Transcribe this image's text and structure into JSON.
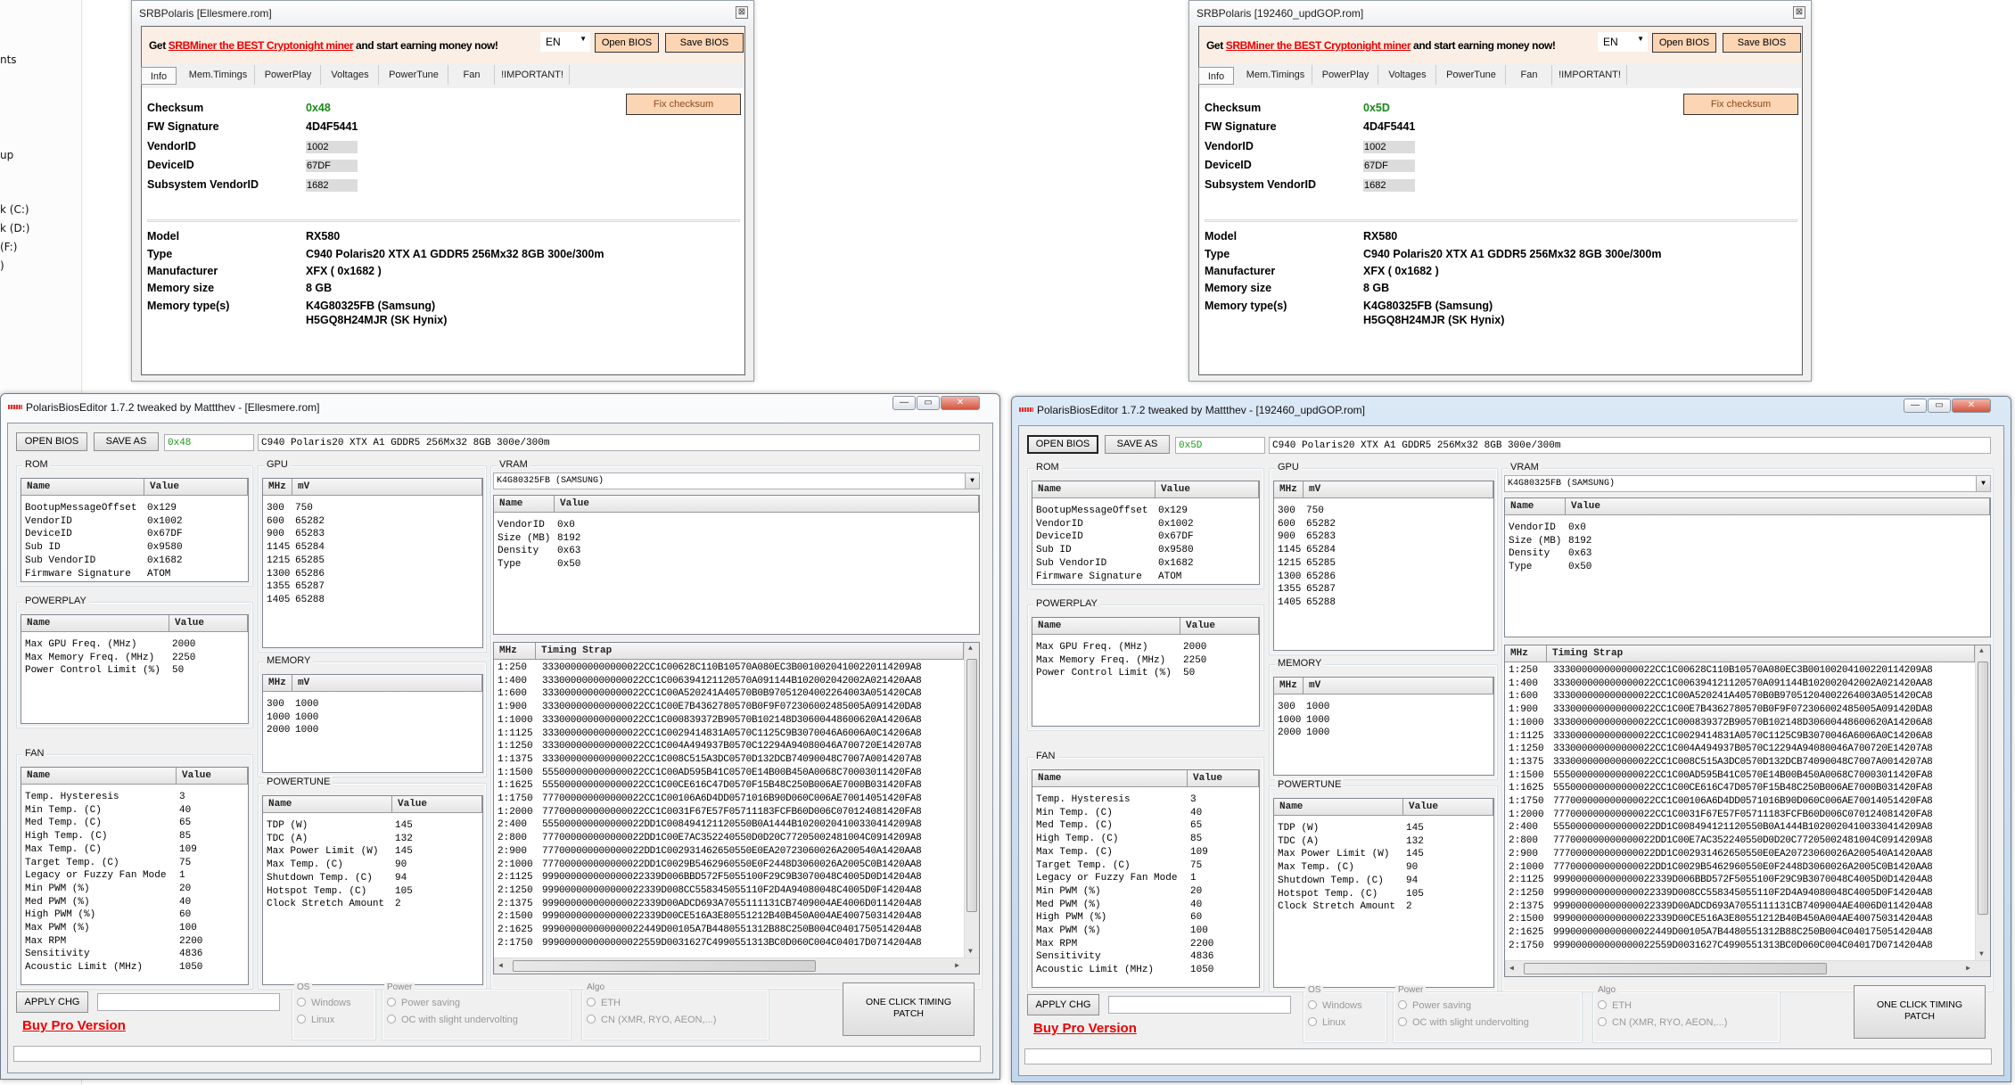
{
  "explorer": {
    "items": [
      "nts",
      "up",
      "k (C:)",
      "k (D:)",
      " (F:)",
      ")"
    ]
  },
  "srb": {
    "promo_prefix": "Get ",
    "promo_link": "SRBMiner the BEST Cryptonight miner",
    "promo_suffix": " and start earning money now!",
    "language": "EN",
    "open_bios": "Open BIOS",
    "save_bios": "Save BIOS",
    "close_glyph": "⊠",
    "tabs": [
      "Info",
      "Mem.Timings",
      "PowerPlay",
      "Voltages",
      "PowerTune",
      "Fan",
      "!IMPORTANT!"
    ],
    "fix_checksum": "Fix checksum",
    "labels": {
      "checksum": "Checksum",
      "fw": "FW Signature",
      "vendor": "VendorID",
      "device": "DeviceID",
      "subsys": "Subsystem VendorID",
      "model": "Model",
      "type": "Type",
      "manufacturer": "Manufacturer",
      "mem_size": "Memory size",
      "mem_types": "Memory type(s)"
    },
    "values": {
      "fw": "4D4F5441",
      "vendor": "1002",
      "device": "67DF",
      "subsys": "1682",
      "model": "RX580",
      "type": "C940 Polaris20 XTX A1 GDDR5 256Mx32 8GB 300e/300m",
      "manufacturer": "XFX ( 0x1682 )",
      "mem_size": "8 GB",
      "mem_type_1": "K4G80325FB (Samsung)",
      "mem_type_2": "H5GQ8H24MJR (SK Hynix)"
    },
    "checksum_color": "#1a8a1a"
  },
  "srb_windows": [
    {
      "title": "SRBPolaris [Ellesmere.rom]",
      "checksum": "0x48"
    },
    {
      "title": "SRBPolaris [192460_updGOP.rom]",
      "checksum": "0x5D"
    }
  ],
  "pbe_windows": [
    {
      "title": "PolarisBiosEditor 1.7.2 tweaked by Mattthev  - [Ellesmere.rom]",
      "checksum": "0x48",
      "active": false
    },
    {
      "title": "PolarisBiosEditor 1.7.2 tweaked by Mattthev  - [192460_updGOP.rom]",
      "checksum": "0x5D",
      "active": true
    }
  ],
  "pbe": {
    "window_buttons": [
      "—",
      "▭",
      "✕"
    ],
    "open_bios": "OPEN BIOS",
    "save_as": "SAVE AS",
    "type_string": "C940 Polaris20 XTX A1 GDDR5 256Mx32 8GB 300e/300m",
    "rom": {
      "title": "ROM",
      "headers": [
        "Name",
        "Value"
      ],
      "rows": [
        [
          "BootupMessageOffset",
          "0x129"
        ],
        [
          "VendorID",
          "0x1002"
        ],
        [
          "DeviceID",
          "0x67DF"
        ],
        [
          "Sub ID",
          "0x9580"
        ],
        [
          "Sub VendorID",
          "0x1682"
        ],
        [
          "Firmware Signature",
          "ATOM"
        ]
      ]
    },
    "powerplay": {
      "title": "POWERPLAY",
      "headers": [
        "Name",
        "Value"
      ],
      "rows": [
        [
          "Max GPU Freq. (MHz)",
          "2000"
        ],
        [
          "Max Memory Freq. (MHz)",
          "2250"
        ],
        [
          "Power Control Limit (%)",
          "50"
        ]
      ]
    },
    "fan": {
      "title": "FAN",
      "headers": [
        "Name",
        "Value"
      ],
      "rows": [
        [
          "Temp. Hysteresis",
          "3"
        ],
        [
          "Min Temp. (C)",
          "40"
        ],
        [
          "Med Temp. (C)",
          "65"
        ],
        [
          "High Temp. (C)",
          "85"
        ],
        [
          "Max Temp. (C)",
          "109"
        ],
        [
          "Target Temp. (C)",
          "75"
        ],
        [
          "Legacy or Fuzzy Fan Mode",
          "1"
        ],
        [
          "Min PWM (%)",
          "20"
        ],
        [
          "Med PWM (%)",
          "40"
        ],
        [
          "High PWM (%)",
          "60"
        ],
        [
          "Max PWM (%)",
          "100"
        ],
        [
          "Max RPM",
          "2200"
        ],
        [
          "Sensitivity",
          "4836"
        ],
        [
          "Acoustic Limit (MHz)",
          "1050"
        ]
      ]
    },
    "gpu": {
      "title": "GPU",
      "headers": [
        "MHz",
        "mV"
      ],
      "rows": [
        [
          "300",
          "750"
        ],
        [
          "600",
          "65282"
        ],
        [
          "900",
          "65283"
        ],
        [
          "1145",
          "65284"
        ],
        [
          "1215",
          "65285"
        ],
        [
          "1300",
          "65286"
        ],
        [
          "1355",
          "65287"
        ],
        [
          "1405",
          "65288"
        ]
      ]
    },
    "memory": {
      "title": "MEMORY",
      "headers": [
        "MHz",
        "mV"
      ],
      "rows": [
        [
          "300",
          "1000"
        ],
        [
          "1000",
          "1000"
        ],
        [
          "2000",
          "1000"
        ]
      ]
    },
    "powertune": {
      "title": "POWERTUNE",
      "headers": [
        "Name",
        "Value"
      ],
      "rows": [
        [
          "TDP (W)",
          "145"
        ],
        [
          "TDC (A)",
          "132"
        ],
        [
          "Max Power Limit (W)",
          "145"
        ],
        [
          "Max Temp. (C)",
          "90"
        ],
        [
          "Shutdown Temp. (C)",
          "94"
        ],
        [
          "Hotspot Temp. (C)",
          "105"
        ],
        [
          "Clock Stretch Amount",
          "2"
        ]
      ]
    },
    "vram": {
      "title": "VRAM",
      "selected": "K4G80325FB (SAMSUNG)",
      "headers": [
        "Name",
        "Value"
      ],
      "rows": [
        [
          "VendorID",
          "0x0"
        ],
        [
          "Size (MB)",
          "8192"
        ],
        [
          "Density",
          "0x63"
        ],
        [
          "Type",
          "0x50"
        ]
      ]
    },
    "timings": {
      "headers": [
        "MHz",
        "Timing Strap"
      ],
      "rows": [
        [
          "1:250",
          "333000000000000022CC1C00628C110B10570A080EC3B00100204100220114209A8"
        ],
        [
          "1:400",
          "333000000000000022CC1C006394121120570A091144B102002042002A021420AA8"
        ],
        [
          "1:600",
          "333000000000000022CC1C00A520241A40570B0B97051204002264003A051420CA8"
        ],
        [
          "1:900",
          "333000000000000022CC1C00E7B4362780570B0F9F072306002485005A091420DA8"
        ],
        [
          "1:1000",
          "333000000000000022CC1C000839372B90570B102148D30600448600620A14206A8"
        ],
        [
          "1:1125",
          "333000000000000022CC1C0029414831A0570C1125C9B3070046A6006A0C14206A8"
        ],
        [
          "1:1250",
          "333000000000000022CC1C004A494937B0570C12294A94080046A700720E14207A8"
        ],
        [
          "1:1375",
          "333000000000000022CC1C008C515A3DC0570D132DCB74090048C7007A0014207A8"
        ],
        [
          "1:1500",
          "555000000000000022CC1C00AD595B41C0570E14B00B450A0068C70003011420FA8"
        ],
        [
          "1:1625",
          "555000000000000022CC1C00CE616C47D0570F15B48C250B006AE7000B031420FA8"
        ],
        [
          "1:1750",
          "777000000000000022CC1C00106A6D4DD0571016B90D060C006AE70014051420FA8"
        ],
        [
          "1:2000",
          "777000000000000022CC1C0031F67E57F05711183FCFB60D006C070124081420FA8"
        ],
        [
          "2:400",
          "555000000000000022DD1C008494121120550B0A1444B10200204100330414209A8"
        ],
        [
          "2:800",
          "777000000000000022DD1C00E7AC352240550D0D20C77205002481004C0914209A8"
        ],
        [
          "2:900",
          "777000000000000022DD1C002931462650550E0EA20723060026A200540A1420AA8"
        ],
        [
          "2:1000",
          "777000000000000022DD1C0029B5462960550E0F2448D3060026A2005C0B1420AA8"
        ],
        [
          "2:1125",
          "999000000000000022339D006BBD572F5055100F29C9B3070048C4005D0D14204A8"
        ],
        [
          "2:1250",
          "999000000000000022339D008CC558345055110F2D4A94080048C4005D0F14204A8"
        ],
        [
          "2:1375",
          "999000000000000022339D00ADCD693A7055111131CB7409004AE4006D0114204A8"
        ],
        [
          "2:1500",
          "999000000000000022339D00CE516A3E80551212B40B450A004AE400750314204A8"
        ],
        [
          "2:1625",
          "999000000000000022449D00105A7B4480551312B88C250B004C0401750514204A8"
        ],
        [
          "2:1750",
          "999000000000000022559D0031627C4990551313BC0D060C004C04017D0714204A8"
        ]
      ]
    },
    "apply_changes": "APPLY CHG",
    "buy_pro": "Buy Pro Version",
    "os": {
      "title": "OS",
      "options": [
        "Windows",
        "Linux"
      ]
    },
    "power": {
      "title": "Power",
      "options": [
        "Power saving",
        "OC with slight undervolting"
      ]
    },
    "algo": {
      "title": "Algo",
      "options": [
        "ETH",
        "CN (XMR, RYO, AEON,...)"
      ]
    },
    "one_click": "ONE CLICK TIMING PATCH"
  }
}
